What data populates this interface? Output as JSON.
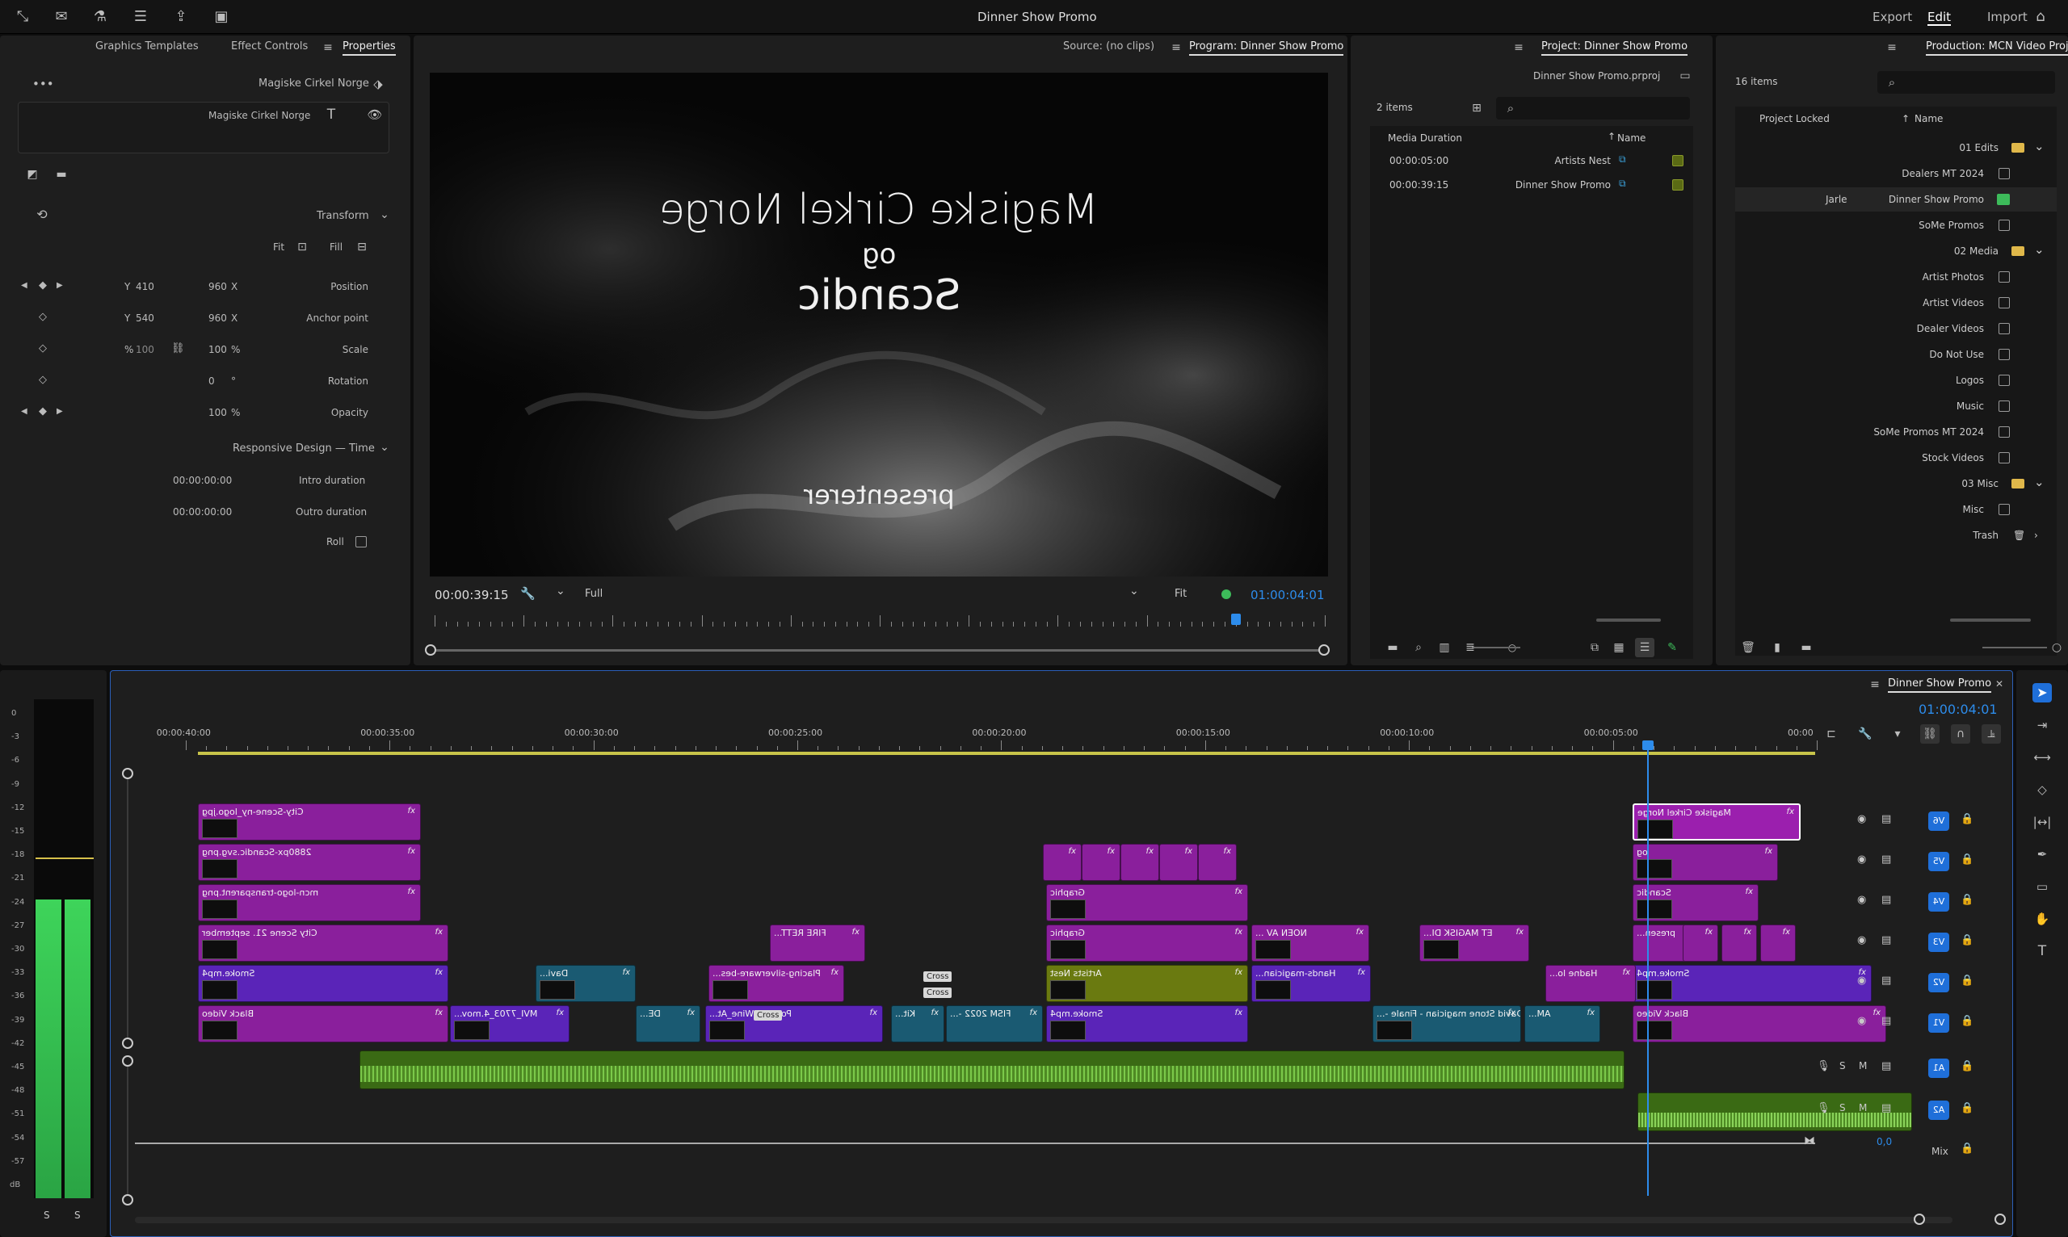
{
  "top_bar": {
    "title": "Dinner Show Promo",
    "nav": [
      "Import",
      "Edit",
      "Export"
    ],
    "active_nav": "Edit"
  },
  "left_panel": {
    "tabs": [
      "Properties",
      "Effect Controls",
      "Graphics Templates"
    ],
    "active_tab": "Properties",
    "layer_name": "Magiske Cirkel Norge",
    "text_layer": "Magiske Cirkel Norge",
    "transform_header": "Transform",
    "fill_label": "Fill",
    "fit_label": "Fit",
    "rows": [
      {
        "label": "Position",
        "x": "960",
        "y": "410",
        "xu": "X",
        "yu": "Y"
      },
      {
        "label": "Anchor point",
        "x": "960",
        "y": "540",
        "xu": "X",
        "yu": "Y"
      },
      {
        "label": "Scale",
        "x": "100",
        "y": "100",
        "xu": "%",
        "yu": "%"
      },
      {
        "label": "Rotation",
        "x": "0",
        "xu": "°"
      },
      {
        "label": "Opacity",
        "x": "100",
        "xu": "%"
      }
    ],
    "responsive_header": "Responsive Design — Time",
    "intro_label": "Intro duration",
    "intro_value": "00:00:00:00",
    "outro_label": "Outro duration",
    "outro_value": "00:00:00:00",
    "roll_label": "Roll"
  },
  "monitor": {
    "tabs": [
      "Program: Dinner Show Promo",
      "Source: (no clips)"
    ],
    "active_tab": "Program: Dinner Show Promo",
    "video_lines": [
      "Magiske Cirkel Norge",
      "og",
      "Scandic",
      "presenterer"
    ],
    "timecode_current": "01:00:04:01",
    "fit": "Fit",
    "quality": "Full",
    "duration": "00:00:39:15",
    "playhead_fraction": 0.1
  },
  "project_small": {
    "title": "Project: Dinner Show Promo",
    "file": "Dinner Show Promo.prproj",
    "items_count": "2 items",
    "col_name": "Name",
    "col_duration": "Media Duration",
    "rows": [
      {
        "name": "Artists Nest",
        "duration": "00:00:05:00"
      },
      {
        "name": "Dinner Show Promo",
        "duration": "00:00:39:15"
      }
    ]
  },
  "production": {
    "title": "Production: MCN Video Projects",
    "items_count": "16 items",
    "col_name": "Name",
    "col_locked": "Project Locked",
    "tree": [
      {
        "name": "01 Edits",
        "type": "folder",
        "level": 0
      },
      {
        "name": "Dealers MT 2024",
        "type": "file",
        "level": 1
      },
      {
        "name": "Dinner Show Promo",
        "type": "file",
        "level": 1,
        "locked_by": "Jarle",
        "active": true
      },
      {
        "name": "SoMe Promos",
        "type": "file",
        "level": 1
      },
      {
        "name": "02 Media",
        "type": "folder",
        "level": 0
      },
      {
        "name": "Artist Photos",
        "type": "file",
        "level": 1
      },
      {
        "name": "Artist Videos",
        "type": "file",
        "level": 1
      },
      {
        "name": "Dealer Videos",
        "type": "file",
        "level": 1
      },
      {
        "name": "Do Not Use",
        "type": "file",
        "level": 1
      },
      {
        "name": "Logos",
        "type": "file",
        "level": 1
      },
      {
        "name": "Music",
        "type": "file",
        "level": 1
      },
      {
        "name": "SoMe Promos MT 2024",
        "type": "file",
        "level": 1
      },
      {
        "name": "Stock Videos",
        "type": "file",
        "level": 1
      },
      {
        "name": "03 Misc",
        "type": "folder",
        "level": 0
      },
      {
        "name": "Misc",
        "type": "file",
        "level": 1
      },
      {
        "name": "Trash",
        "type": "trash",
        "level": 0
      }
    ]
  },
  "audio_meter": {
    "scale": [
      "0",
      "-3",
      "-6",
      "-9",
      "-12",
      "-15",
      "-18",
      "-21",
      "-24",
      "-27",
      "-30",
      "-33",
      "-36",
      "-39",
      "-42",
      "-45",
      "-48",
      "-51",
      "-54",
      "-57",
      "dB"
    ],
    "channels": [
      "S",
      "S"
    ]
  },
  "timeline": {
    "sequence_tab": "Dinner Show Promo",
    "timecode": "01:00:04:01",
    "ruler": [
      "00:00",
      "00:00:05:00",
      "00:00:10:00",
      "00:00:15:00",
      "00:00:20:00",
      "00:00:25:00",
      "00:00:30:00",
      "00:00:35:00",
      "00:00:40:00"
    ],
    "tracks": [
      {
        "id": "V6",
        "label": "V6"
      },
      {
        "id": "V5",
        "label": "V5"
      },
      {
        "id": "V4",
        "label": "V4"
      },
      {
        "id": "V3",
        "label": "V3"
      },
      {
        "id": "V2",
        "label": "V2"
      },
      {
        "id": "V1",
        "label": "V1"
      },
      {
        "id": "A1",
        "label": "A1"
      },
      {
        "id": "A2",
        "label": "A2"
      }
    ],
    "track_letters": {
      "mute": "M",
      "solo": "S"
    },
    "mix_label": "Mix",
    "mix_value": "0,0",
    "clips": [
      {
        "track": 0,
        "name": "Magiske Cirkel Norge",
        "color": "#9b1fae"
      },
      {
        "track": 0,
        "name": "City-Scene-ny_logo.jpg",
        "color": "#8a1f9c"
      },
      {
        "track": 1,
        "name": "og",
        "color": "#8a1f9c"
      },
      {
        "track": 1,
        "name": "2880px-Scandic.svg.png",
        "color": "#8a1f9c"
      },
      {
        "track": 2,
        "name": "Scandic",
        "color": "#8a1f9c"
      },
      {
        "track": 2,
        "name": "Graphic",
        "color": "#8a1f9c"
      },
      {
        "track": 2,
        "name": "mcn-logo-transparent.png",
        "color": "#8a1f9c"
      },
      {
        "track": 3,
        "name": "presen...",
        "color": "#8a1f9c"
      },
      {
        "track": 3,
        "name": "ET MAGISK DI...",
        "color": "#8a1f9c"
      },
      {
        "track": 3,
        "name": "NOEN AV ...",
        "color": "#8a1f9c"
      },
      {
        "track": 3,
        "name": "Graphic",
        "color": "#8a1f9c"
      },
      {
        "track": 3,
        "name": "FIRE RETT...",
        "color": "#8a1f9c"
      },
      {
        "track": 3,
        "name": "City Scene 21. september",
        "color": "#8a1f9c"
      },
      {
        "track": 4,
        "name": "Smoke.mp4",
        "color": "#5a24b8"
      },
      {
        "track": 4,
        "name": "Hadne lo...",
        "color": "#8a1f9c"
      },
      {
        "track": 4,
        "name": "Hands-magician...",
        "color": "#5a24b8"
      },
      {
        "track": 4,
        "name": "Artists Nest",
        "color": "#6a7a10"
      },
      {
        "track": 4,
        "name": "Placing-silverware-bes...",
        "color": "#8a1f9c"
      },
      {
        "track": 4,
        "name": "Davi...",
        "color": "#1a5a72"
      },
      {
        "track": 4,
        "name": "Smoke.mp4",
        "color": "#5a24b8"
      },
      {
        "track": 5,
        "name": "Black Video",
        "color": "#8a1f9c"
      },
      {
        "track": 5,
        "name": "AM...",
        "color": "#1a5a72"
      },
      {
        "track": 5,
        "name": "David Stone magician - Finale -...",
        "color": "#1a5a72"
      },
      {
        "track": 5,
        "name": "Smoke.mp4",
        "color": "#5a24b8"
      },
      {
        "track": 5,
        "name": "FISM 2022 -...",
        "color": "#1a5a72"
      },
      {
        "track": 5,
        "name": "Kit...",
        "color": "#1a5a72"
      },
      {
        "track": 5,
        "name": "Pouring_Wine_At...",
        "color": "#5a24b8"
      },
      {
        "track": 5,
        "name": "Wa...",
        "color": "#5a24b8"
      },
      {
        "track": 5,
        "name": "DE...",
        "color": "#1a5a72"
      },
      {
        "track": 5,
        "name": "MVI_7703_4.mov...",
        "color": "#5a24b8"
      },
      {
        "track": 5,
        "name": "Black Video",
        "color": "#8a1f9c"
      }
    ],
    "transition_labels": [
      "Cross",
      "Cross",
      "Cross"
    ],
    "fx": "fx",
    "playhead_time": "01:00:04:01"
  }
}
